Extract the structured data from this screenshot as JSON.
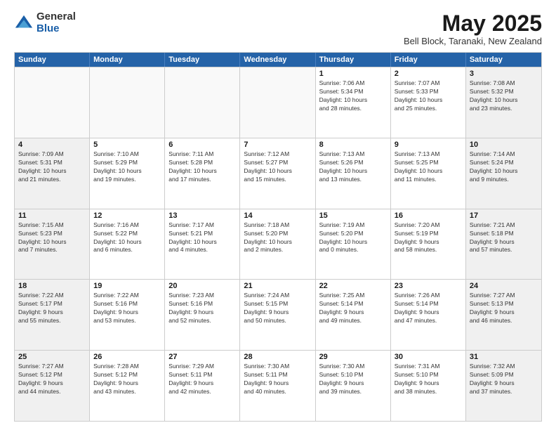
{
  "logo": {
    "general": "General",
    "blue": "Blue"
  },
  "title": "May 2025",
  "location": "Bell Block, Taranaki, New Zealand",
  "header_days": [
    "Sunday",
    "Monday",
    "Tuesday",
    "Wednesday",
    "Thursday",
    "Friday",
    "Saturday"
  ],
  "rows": [
    [
      {
        "day": "",
        "empty": true
      },
      {
        "day": "",
        "empty": true
      },
      {
        "day": "",
        "empty": true
      },
      {
        "day": "",
        "empty": true
      },
      {
        "day": "1",
        "lines": [
          "Sunrise: 7:06 AM",
          "Sunset: 5:34 PM",
          "Daylight: 10 hours",
          "and 28 minutes."
        ]
      },
      {
        "day": "2",
        "lines": [
          "Sunrise: 7:07 AM",
          "Sunset: 5:33 PM",
          "Daylight: 10 hours",
          "and 25 minutes."
        ]
      },
      {
        "day": "3",
        "shaded": true,
        "lines": [
          "Sunrise: 7:08 AM",
          "Sunset: 5:32 PM",
          "Daylight: 10 hours",
          "and 23 minutes."
        ]
      }
    ],
    [
      {
        "day": "4",
        "shaded": true,
        "lines": [
          "Sunrise: 7:09 AM",
          "Sunset: 5:31 PM",
          "Daylight: 10 hours",
          "and 21 minutes."
        ]
      },
      {
        "day": "5",
        "lines": [
          "Sunrise: 7:10 AM",
          "Sunset: 5:29 PM",
          "Daylight: 10 hours",
          "and 19 minutes."
        ]
      },
      {
        "day": "6",
        "lines": [
          "Sunrise: 7:11 AM",
          "Sunset: 5:28 PM",
          "Daylight: 10 hours",
          "and 17 minutes."
        ]
      },
      {
        "day": "7",
        "lines": [
          "Sunrise: 7:12 AM",
          "Sunset: 5:27 PM",
          "Daylight: 10 hours",
          "and 15 minutes."
        ]
      },
      {
        "day": "8",
        "lines": [
          "Sunrise: 7:13 AM",
          "Sunset: 5:26 PM",
          "Daylight: 10 hours",
          "and 13 minutes."
        ]
      },
      {
        "day": "9",
        "lines": [
          "Sunrise: 7:13 AM",
          "Sunset: 5:25 PM",
          "Daylight: 10 hours",
          "and 11 minutes."
        ]
      },
      {
        "day": "10",
        "shaded": true,
        "lines": [
          "Sunrise: 7:14 AM",
          "Sunset: 5:24 PM",
          "Daylight: 10 hours",
          "and 9 minutes."
        ]
      }
    ],
    [
      {
        "day": "11",
        "shaded": true,
        "lines": [
          "Sunrise: 7:15 AM",
          "Sunset: 5:23 PM",
          "Daylight: 10 hours",
          "and 7 minutes."
        ]
      },
      {
        "day": "12",
        "lines": [
          "Sunrise: 7:16 AM",
          "Sunset: 5:22 PM",
          "Daylight: 10 hours",
          "and 6 minutes."
        ]
      },
      {
        "day": "13",
        "lines": [
          "Sunrise: 7:17 AM",
          "Sunset: 5:21 PM",
          "Daylight: 10 hours",
          "and 4 minutes."
        ]
      },
      {
        "day": "14",
        "lines": [
          "Sunrise: 7:18 AM",
          "Sunset: 5:20 PM",
          "Daylight: 10 hours",
          "and 2 minutes."
        ]
      },
      {
        "day": "15",
        "lines": [
          "Sunrise: 7:19 AM",
          "Sunset: 5:20 PM",
          "Daylight: 10 hours",
          "and 0 minutes."
        ]
      },
      {
        "day": "16",
        "lines": [
          "Sunrise: 7:20 AM",
          "Sunset: 5:19 PM",
          "Daylight: 9 hours",
          "and 58 minutes."
        ]
      },
      {
        "day": "17",
        "shaded": true,
        "lines": [
          "Sunrise: 7:21 AM",
          "Sunset: 5:18 PM",
          "Daylight: 9 hours",
          "and 57 minutes."
        ]
      }
    ],
    [
      {
        "day": "18",
        "shaded": true,
        "lines": [
          "Sunrise: 7:22 AM",
          "Sunset: 5:17 PM",
          "Daylight: 9 hours",
          "and 55 minutes."
        ]
      },
      {
        "day": "19",
        "lines": [
          "Sunrise: 7:22 AM",
          "Sunset: 5:16 PM",
          "Daylight: 9 hours",
          "and 53 minutes."
        ]
      },
      {
        "day": "20",
        "lines": [
          "Sunrise: 7:23 AM",
          "Sunset: 5:16 PM",
          "Daylight: 9 hours",
          "and 52 minutes."
        ]
      },
      {
        "day": "21",
        "lines": [
          "Sunrise: 7:24 AM",
          "Sunset: 5:15 PM",
          "Daylight: 9 hours",
          "and 50 minutes."
        ]
      },
      {
        "day": "22",
        "lines": [
          "Sunrise: 7:25 AM",
          "Sunset: 5:14 PM",
          "Daylight: 9 hours",
          "and 49 minutes."
        ]
      },
      {
        "day": "23",
        "lines": [
          "Sunrise: 7:26 AM",
          "Sunset: 5:14 PM",
          "Daylight: 9 hours",
          "and 47 minutes."
        ]
      },
      {
        "day": "24",
        "shaded": true,
        "lines": [
          "Sunrise: 7:27 AM",
          "Sunset: 5:13 PM",
          "Daylight: 9 hours",
          "and 46 minutes."
        ]
      }
    ],
    [
      {
        "day": "25",
        "shaded": true,
        "lines": [
          "Sunrise: 7:27 AM",
          "Sunset: 5:12 PM",
          "Daylight: 9 hours",
          "and 44 minutes."
        ]
      },
      {
        "day": "26",
        "lines": [
          "Sunrise: 7:28 AM",
          "Sunset: 5:12 PM",
          "Daylight: 9 hours",
          "and 43 minutes."
        ]
      },
      {
        "day": "27",
        "lines": [
          "Sunrise: 7:29 AM",
          "Sunset: 5:11 PM",
          "Daylight: 9 hours",
          "and 42 minutes."
        ]
      },
      {
        "day": "28",
        "lines": [
          "Sunrise: 7:30 AM",
          "Sunset: 5:11 PM",
          "Daylight: 9 hours",
          "and 40 minutes."
        ]
      },
      {
        "day": "29",
        "lines": [
          "Sunrise: 7:30 AM",
          "Sunset: 5:10 PM",
          "Daylight: 9 hours",
          "and 39 minutes."
        ]
      },
      {
        "day": "30",
        "lines": [
          "Sunrise: 7:31 AM",
          "Sunset: 5:10 PM",
          "Daylight: 9 hours",
          "and 38 minutes."
        ]
      },
      {
        "day": "31",
        "shaded": true,
        "lines": [
          "Sunrise: 7:32 AM",
          "Sunset: 5:09 PM",
          "Daylight: 9 hours",
          "and 37 minutes."
        ]
      }
    ]
  ]
}
